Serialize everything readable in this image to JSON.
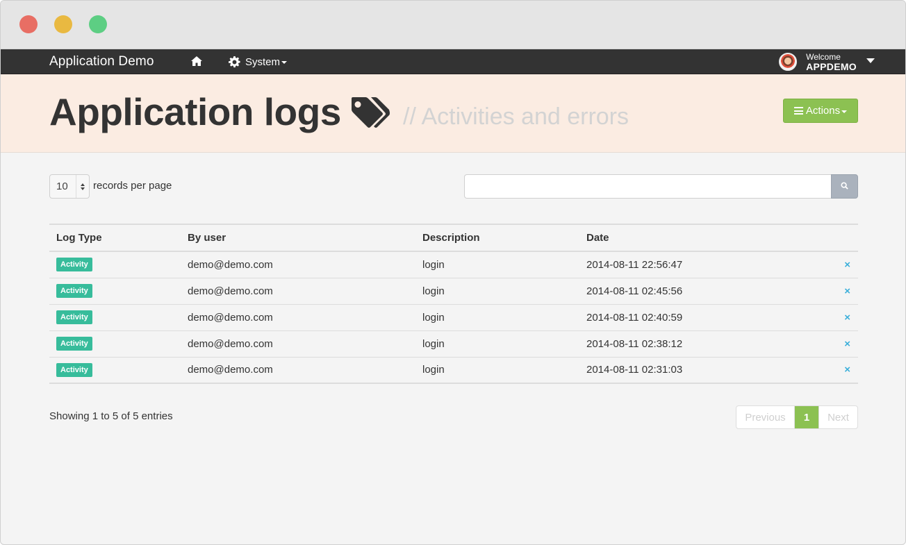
{
  "window": {
    "controls": [
      "close",
      "minimize",
      "maximize"
    ]
  },
  "navbar": {
    "brand": "Application Demo",
    "home_icon": "home-icon",
    "system_label": "System",
    "system_icon": "gear-icon",
    "user": {
      "welcome": "Welcome",
      "name": "APPDEMO"
    }
  },
  "header": {
    "title": "Application logs",
    "title_icon": "tags-icon",
    "subtitle": "// Activities and errors",
    "actions_label": "Actions"
  },
  "controls": {
    "length_value": "10",
    "length_label": "records per page",
    "search_value": "",
    "search_placeholder": ""
  },
  "table": {
    "columns": [
      "Log Type",
      "By user",
      "Description",
      "Date"
    ],
    "rows": [
      {
        "type": "Activity",
        "user": "demo@demo.com",
        "description": "login",
        "date": "2014-08-11 22:56:47"
      },
      {
        "type": "Activity",
        "user": "demo@demo.com",
        "description": "login",
        "date": "2014-08-11 02:45:56"
      },
      {
        "type": "Activity",
        "user": "demo@demo.com",
        "description": "login",
        "date": "2014-08-11 02:40:59"
      },
      {
        "type": "Activity",
        "user": "demo@demo.com",
        "description": "login",
        "date": "2014-08-11 02:38:12"
      },
      {
        "type": "Activity",
        "user": "demo@demo.com",
        "description": "login",
        "date": "2014-08-11 02:31:03"
      }
    ],
    "delete_icon": "×"
  },
  "footer": {
    "info": "Showing 1 to 5 of 5 entries",
    "pagination": {
      "previous": "Previous",
      "current": "1",
      "next": "Next"
    }
  },
  "colors": {
    "navbar": "#333333",
    "header_bg": "#fbece2",
    "accent_green": "#8cc152",
    "badge_teal": "#37bc9b",
    "delete_blue": "#3bafda",
    "subtitle_gray": "#d3d3d3"
  }
}
